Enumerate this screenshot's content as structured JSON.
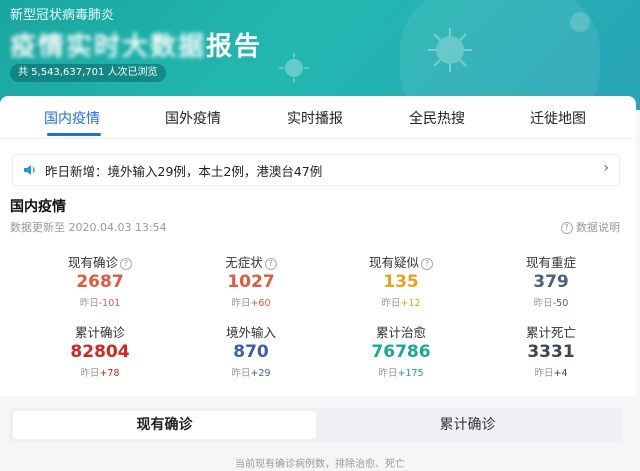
{
  "banner": {
    "subtitle": "新型冠状病毒肺炎",
    "title_blurred": "疫情实时大数据",
    "title_suffix": "报告",
    "views": "共 5,543,637,701 人次已浏览"
  },
  "tabs": [
    "国内疫情",
    "国外疫情",
    "实时播报",
    "全民热搜",
    "迁徙地图"
  ],
  "notice": {
    "text": "昨日新增：境外输入29例，本土2例，港澳台47例"
  },
  "section": {
    "title": "国内疫情",
    "updated": "数据更新至 2020.04.03 13:54",
    "data_note": "数据说明"
  },
  "stats_row1": [
    {
      "label": "现有确诊",
      "value": "2687",
      "delta_prefix": "昨日",
      "delta": "-101",
      "value_color": "#e15a3c",
      "delta_color": "#e15a3c",
      "info": true
    },
    {
      "label": "无症状",
      "value": "1027",
      "delta_prefix": "昨日",
      "delta": "+60",
      "value_color": "#e15a3c",
      "delta_color": "#e15a3c",
      "info": true
    },
    {
      "label": "现有疑似",
      "value": "135",
      "delta_prefix": "昨日",
      "delta": "+12",
      "value_color": "#e8a31e",
      "delta_color": "#e8a31e",
      "info": true
    },
    {
      "label": "现有重症",
      "value": "379",
      "delta_prefix": "昨日",
      "delta": "-50",
      "value_color": "#4a5e8a",
      "delta_color": "#4a5e8a",
      "info": false
    }
  ],
  "stats_row2": [
    {
      "label": "累计确诊",
      "value": "82804",
      "delta_prefix": "昨日",
      "delta": "+78",
      "value_color": "#d2271d",
      "delta_color": "#d2271d"
    },
    {
      "label": "境外输入",
      "value": "870",
      "delta_prefix": "昨日",
      "delta": "+29",
      "value_color": "#3a5fa8",
      "delta_color": "#3a5fa8"
    },
    {
      "label": "累计治愈",
      "value": "76786",
      "delta_prefix": "昨日",
      "delta": "+175",
      "value_color": "#1aa79a",
      "delta_color": "#1aa79a"
    },
    {
      "label": "累计死亡",
      "value": "3331",
      "delta_prefix": "昨日",
      "delta": "+4",
      "value_color": "#3d4657",
      "delta_color": "#3d4657"
    }
  ],
  "segment": {
    "active": "现有确诊",
    "inactive": "累计确诊"
  },
  "footnote": "当前现有确诊病例数，排除治愈、死亡"
}
